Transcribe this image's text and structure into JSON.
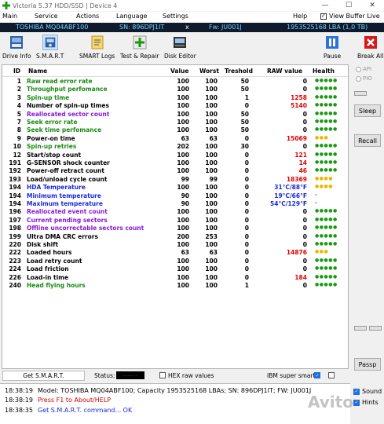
{
  "window": {
    "title": "Victoria 5.37 HDD/SSD | Device 4",
    "min": "—",
    "max": "☐",
    "close": "✕"
  },
  "menu": {
    "items": [
      "Main",
      "Service",
      "Actions",
      "Language",
      "Settings",
      "Help"
    ],
    "view_buffer_live": "View Buffer Live"
  },
  "drive": {
    "model": "TOSHIBA MQ04ABF100",
    "sn": "SN: 896DPJ1IT",
    "x": "x",
    "fw": "Fw: JU001J",
    "lba": "1953525168 LBA (1,0 TB)"
  },
  "toolbar": {
    "buttons": [
      "Drive Info",
      "S.M.A.R.T",
      "SMART Logs",
      "Test & Repair",
      "Disk Editor",
      "Pause",
      "Break All"
    ]
  },
  "colors": {
    "green": "#1a8a12",
    "purple": "#8a1ad6",
    "red": "#e00000",
    "blue": "#1a2ad6",
    "black": "#000000",
    "dots_green": "#1a9a12",
    "dots_yellow": "#e6b800"
  },
  "table": {
    "headers": {
      "id": "ID",
      "name": "Name",
      "value": "Value",
      "worst": "Worst",
      "threshold": "Treshold",
      "raw": "RAW value",
      "health": "Health"
    },
    "rows": [
      {
        "id": "1",
        "name": "Raw read error rate",
        "value": "100",
        "worst": "100",
        "threshold": "50",
        "raw": "0",
        "health": "●●●●●",
        "name_color": "green",
        "raw_color": "black",
        "health_color": "dots_green"
      },
      {
        "id": "2",
        "name": "Throughput perfomance",
        "value": "100",
        "worst": "100",
        "threshold": "50",
        "raw": "0",
        "health": "●●●●●",
        "name_color": "green",
        "raw_color": "black",
        "health_color": "dots_green"
      },
      {
        "id": "3",
        "name": "Spin-up time",
        "value": "100",
        "worst": "100",
        "threshold": "1",
        "raw": "1258",
        "health": "●●●●●",
        "name_color": "green",
        "raw_color": "red",
        "health_color": "dots_green"
      },
      {
        "id": "4",
        "name": "Number of spin-up times",
        "value": "100",
        "worst": "100",
        "threshold": "0",
        "raw": "5140",
        "health": "●●●●●",
        "name_color": "black",
        "raw_color": "red",
        "health_color": "dots_green"
      },
      {
        "id": "5",
        "name": "Reallocated sector count",
        "value": "100",
        "worst": "100",
        "threshold": "50",
        "raw": "0",
        "health": "●●●●●",
        "name_color": "purple",
        "raw_color": "black",
        "health_color": "dots_green"
      },
      {
        "id": "7",
        "name": "Seek error rate",
        "value": "100",
        "worst": "100",
        "threshold": "50",
        "raw": "0",
        "health": "●●●●●",
        "name_color": "green",
        "raw_color": "black",
        "health_color": "dots_green"
      },
      {
        "id": "8",
        "name": "Seek time perfomance",
        "value": "100",
        "worst": "100",
        "threshold": "50",
        "raw": "0",
        "health": "●●●●●",
        "name_color": "green",
        "raw_color": "black",
        "health_color": "dots_green"
      },
      {
        "id": "9",
        "name": "Power-on time",
        "value": "63",
        "worst": "63",
        "threshold": "0",
        "raw": "15069",
        "health": "●●●",
        "name_color": "black",
        "raw_color": "red",
        "health_color": "dots_yellow"
      },
      {
        "id": "10",
        "name": "Spin-up retries",
        "value": "202",
        "worst": "100",
        "threshold": "30",
        "raw": "0",
        "health": "●●●●●",
        "name_color": "green",
        "raw_color": "black",
        "health_color": "dots_green"
      },
      {
        "id": "12",
        "name": "Start/stop count",
        "value": "100",
        "worst": "100",
        "threshold": "0",
        "raw": "121",
        "health": "●●●●●",
        "name_color": "black",
        "raw_color": "red",
        "health_color": "dots_green"
      },
      {
        "id": "191",
        "name": "G-SENSOR shock counter",
        "value": "100",
        "worst": "100",
        "threshold": "0",
        "raw": "14",
        "health": "●●●●●",
        "name_color": "black",
        "raw_color": "red",
        "health_color": "dots_green"
      },
      {
        "id": "192",
        "name": "Power-off retract count",
        "value": "100",
        "worst": "100",
        "threshold": "0",
        "raw": "46",
        "health": "●●●●●",
        "name_color": "black",
        "raw_color": "red",
        "health_color": "dots_green"
      },
      {
        "id": "193",
        "name": "Load/unload cycle count",
        "value": "99",
        "worst": "99",
        "threshold": "0",
        "raw": "18369",
        "health": "●●●●",
        "name_color": "black",
        "raw_color": "red",
        "health_color": "dots_yellow"
      },
      {
        "id": "194",
        "name": "HDA Temperature",
        "value": "100",
        "worst": "100",
        "threshold": "0",
        "raw": "31°C/88°F",
        "health": "●●●●",
        "name_color": "blue",
        "raw_color": "blue",
        "health_color": "dots_yellow"
      },
      {
        "id": "194",
        "name": "Minimum temperature",
        "value": "90",
        "worst": "100",
        "threshold": "0",
        "raw": "19°C/66°F",
        "health": "-",
        "name_color": "blue",
        "raw_color": "blue",
        "health_color": "dots_green"
      },
      {
        "id": "194",
        "name": "Maximum temperature",
        "value": "90",
        "worst": "100",
        "threshold": "0",
        "raw": "54°C/129°F",
        "health": "-",
        "name_color": "blue",
        "raw_color": "blue",
        "health_color": "dots_green"
      },
      {
        "id": "196",
        "name": "Reallocated event count",
        "value": "100",
        "worst": "100",
        "threshold": "0",
        "raw": "0",
        "health": "●●●●●",
        "name_color": "purple",
        "raw_color": "black",
        "health_color": "dots_green"
      },
      {
        "id": "197",
        "name": "Current pending sectors",
        "value": "100",
        "worst": "100",
        "threshold": "0",
        "raw": "0",
        "health": "●●●●●",
        "name_color": "purple",
        "raw_color": "black",
        "health_color": "dots_green"
      },
      {
        "id": "198",
        "name": "Offline uncorrectable sectors count",
        "value": "100",
        "worst": "100",
        "threshold": "0",
        "raw": "0",
        "health": "●●●●●",
        "name_color": "purple",
        "raw_color": "black",
        "health_color": "dots_green"
      },
      {
        "id": "199",
        "name": "Ultra DMA CRC errors",
        "value": "200",
        "worst": "253",
        "threshold": "0",
        "raw": "0",
        "health": "●●●●●",
        "name_color": "black",
        "raw_color": "black",
        "health_color": "dots_green"
      },
      {
        "id": "220",
        "name": "Disk shift",
        "value": "100",
        "worst": "100",
        "threshold": "0",
        "raw": "0",
        "health": "●●●●●",
        "name_color": "black",
        "raw_color": "black",
        "health_color": "dots_green"
      },
      {
        "id": "222",
        "name": "Loaded hours",
        "value": "63",
        "worst": "63",
        "threshold": "0",
        "raw": "14876",
        "health": "●●●",
        "name_color": "black",
        "raw_color": "red",
        "health_color": "dots_yellow"
      },
      {
        "id": "223",
        "name": "Load retry count",
        "value": "100",
        "worst": "100",
        "threshold": "0",
        "raw": "0",
        "health": "●●●●●",
        "name_color": "black",
        "raw_color": "black",
        "health_color": "dots_green"
      },
      {
        "id": "224",
        "name": "Load friction",
        "value": "100",
        "worst": "100",
        "threshold": "0",
        "raw": "0",
        "health": "●●●●●",
        "name_color": "black",
        "raw_color": "black",
        "health_color": "dots_green"
      },
      {
        "id": "226",
        "name": "Load-in time",
        "value": "100",
        "worst": "100",
        "threshold": "0",
        "raw": "184",
        "health": "●●●●●",
        "name_color": "black",
        "raw_color": "red",
        "health_color": "dots_green"
      },
      {
        "id": "240",
        "name": "Head flying hours",
        "value": "100",
        "worst": "100",
        "threshold": "1",
        "raw": "0",
        "health": "●●●●●",
        "name_color": "green",
        "raw_color": "black",
        "health_color": "dots_green"
      }
    ]
  },
  "side": {
    "api": "API",
    "pio": "PIO",
    "sleep": "Sleep",
    "recall": "Recall",
    "passp": "Passp"
  },
  "statusbar": {
    "get_smart": "Get S.M.A.R.T.",
    "status_label": "Status:",
    "status_value": "------",
    "hex_raw": "HEX raw values",
    "ibm_smart": "IBM super smart:"
  },
  "log": [
    {
      "time": "18:38:19",
      "text": "Model: TOSHIBA MQ04ABF100; Capacity 1953525168 LBAs; SN: 896DPJ1IT; FW: JU001J",
      "color": "#000000"
    },
    {
      "time": "18:38:19",
      "text": "Press F1 to About/HELP",
      "color": "#cc0000"
    },
    {
      "time": "18:38:35",
      "text": "Get S.M.A.R.T. command... OK",
      "color": "#1a2ad6"
    }
  ],
  "bottom_right": {
    "sound": "Sound",
    "hints": "Hints"
  },
  "watermark": "Avito"
}
